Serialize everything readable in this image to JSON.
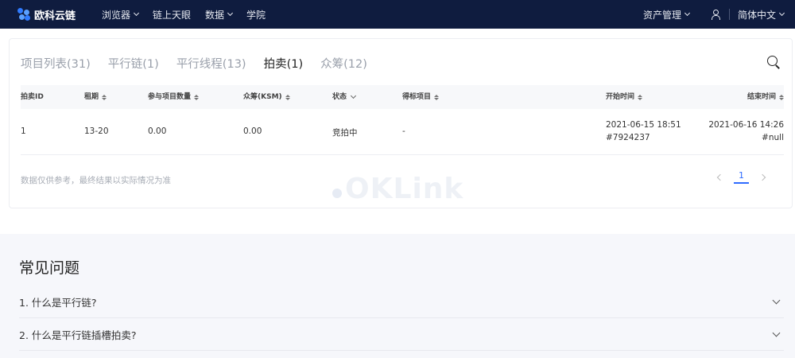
{
  "nav": {
    "brand": "欧科云链",
    "items": [
      {
        "label": "浏览器",
        "has_caret": true
      },
      {
        "label": "链上天眼",
        "has_caret": false
      },
      {
        "label": "数据",
        "has_caret": true
      },
      {
        "label": "学院",
        "has_caret": false
      }
    ],
    "asset_label": "资产管理",
    "language_label": "简体中文"
  },
  "tabs": [
    {
      "label": "项目列表(31)",
      "active": false
    },
    {
      "label": "平行链(1)",
      "active": false
    },
    {
      "label": "平行线程(13)",
      "active": false
    },
    {
      "label": "拍卖(1)",
      "active": true
    },
    {
      "label": "众筹(12)",
      "active": false
    }
  ],
  "table": {
    "headers": [
      "拍卖ID",
      "租期",
      "参与项目数量",
      "众筹(KSM)",
      "状态",
      "得标项目",
      "开始时间",
      "结束时间"
    ],
    "rows": [
      {
        "auction_id": "1",
        "lease": "13-20",
        "project_count": "0.00",
        "crowdloan": "0.00",
        "status": "竞拍中",
        "winner": "-",
        "start_time": "2021-06-15 18:51",
        "start_block": "#7924237",
        "end_time": "2021-06-16 14:26",
        "end_block": "#null"
      }
    ]
  },
  "watermark": "OKLink",
  "footnote": "数据仅供参考，最终结果以实际情况为准",
  "pagination": {
    "current": "1"
  },
  "faq": {
    "title": "常见问题",
    "items": [
      "1. 什么是平行链?",
      "2. 什么是平行链插槽拍卖?"
    ]
  },
  "colors": {
    "topbar": "#0f1c3f",
    "accent": "#2f6bff",
    "faq_bg": "#f6f7fb"
  }
}
